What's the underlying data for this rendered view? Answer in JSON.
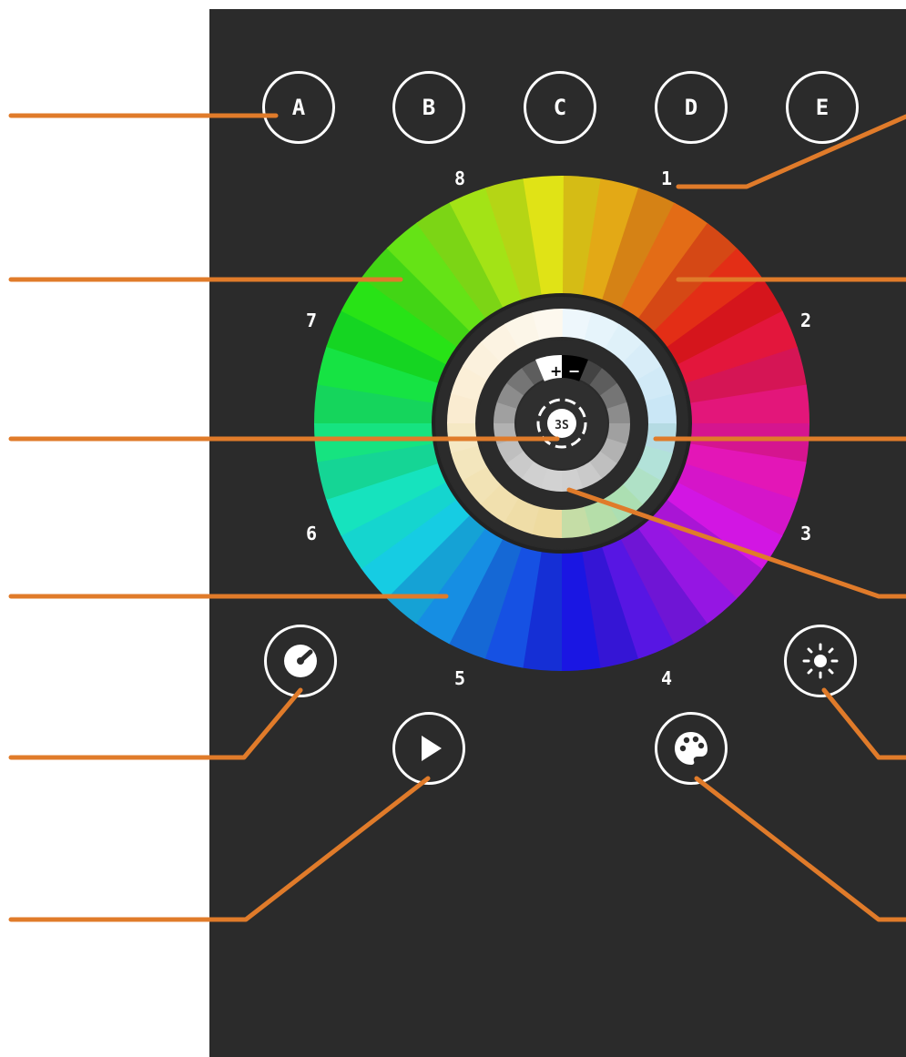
{
  "scene_buttons": [
    {
      "label": "A"
    },
    {
      "label": "B"
    },
    {
      "label": "C"
    },
    {
      "label": "D"
    },
    {
      "label": "E"
    }
  ],
  "wheel_numbers": [
    "1",
    "2",
    "3",
    "4",
    "5",
    "6",
    "7",
    "8"
  ],
  "center_button": {
    "label": "3S"
  },
  "plus_minus": {
    "plus": "+",
    "minus": "−"
  },
  "controls": {
    "speed_icon": "speedometer-icon",
    "brightness_icon": "sun-icon",
    "play_icon": "play-icon",
    "palette_icon": "palette-icon"
  },
  "colors": {
    "panel": "#2b2b2b",
    "callout": "#e07b2a",
    "ring_border": "#ffffff"
  }
}
